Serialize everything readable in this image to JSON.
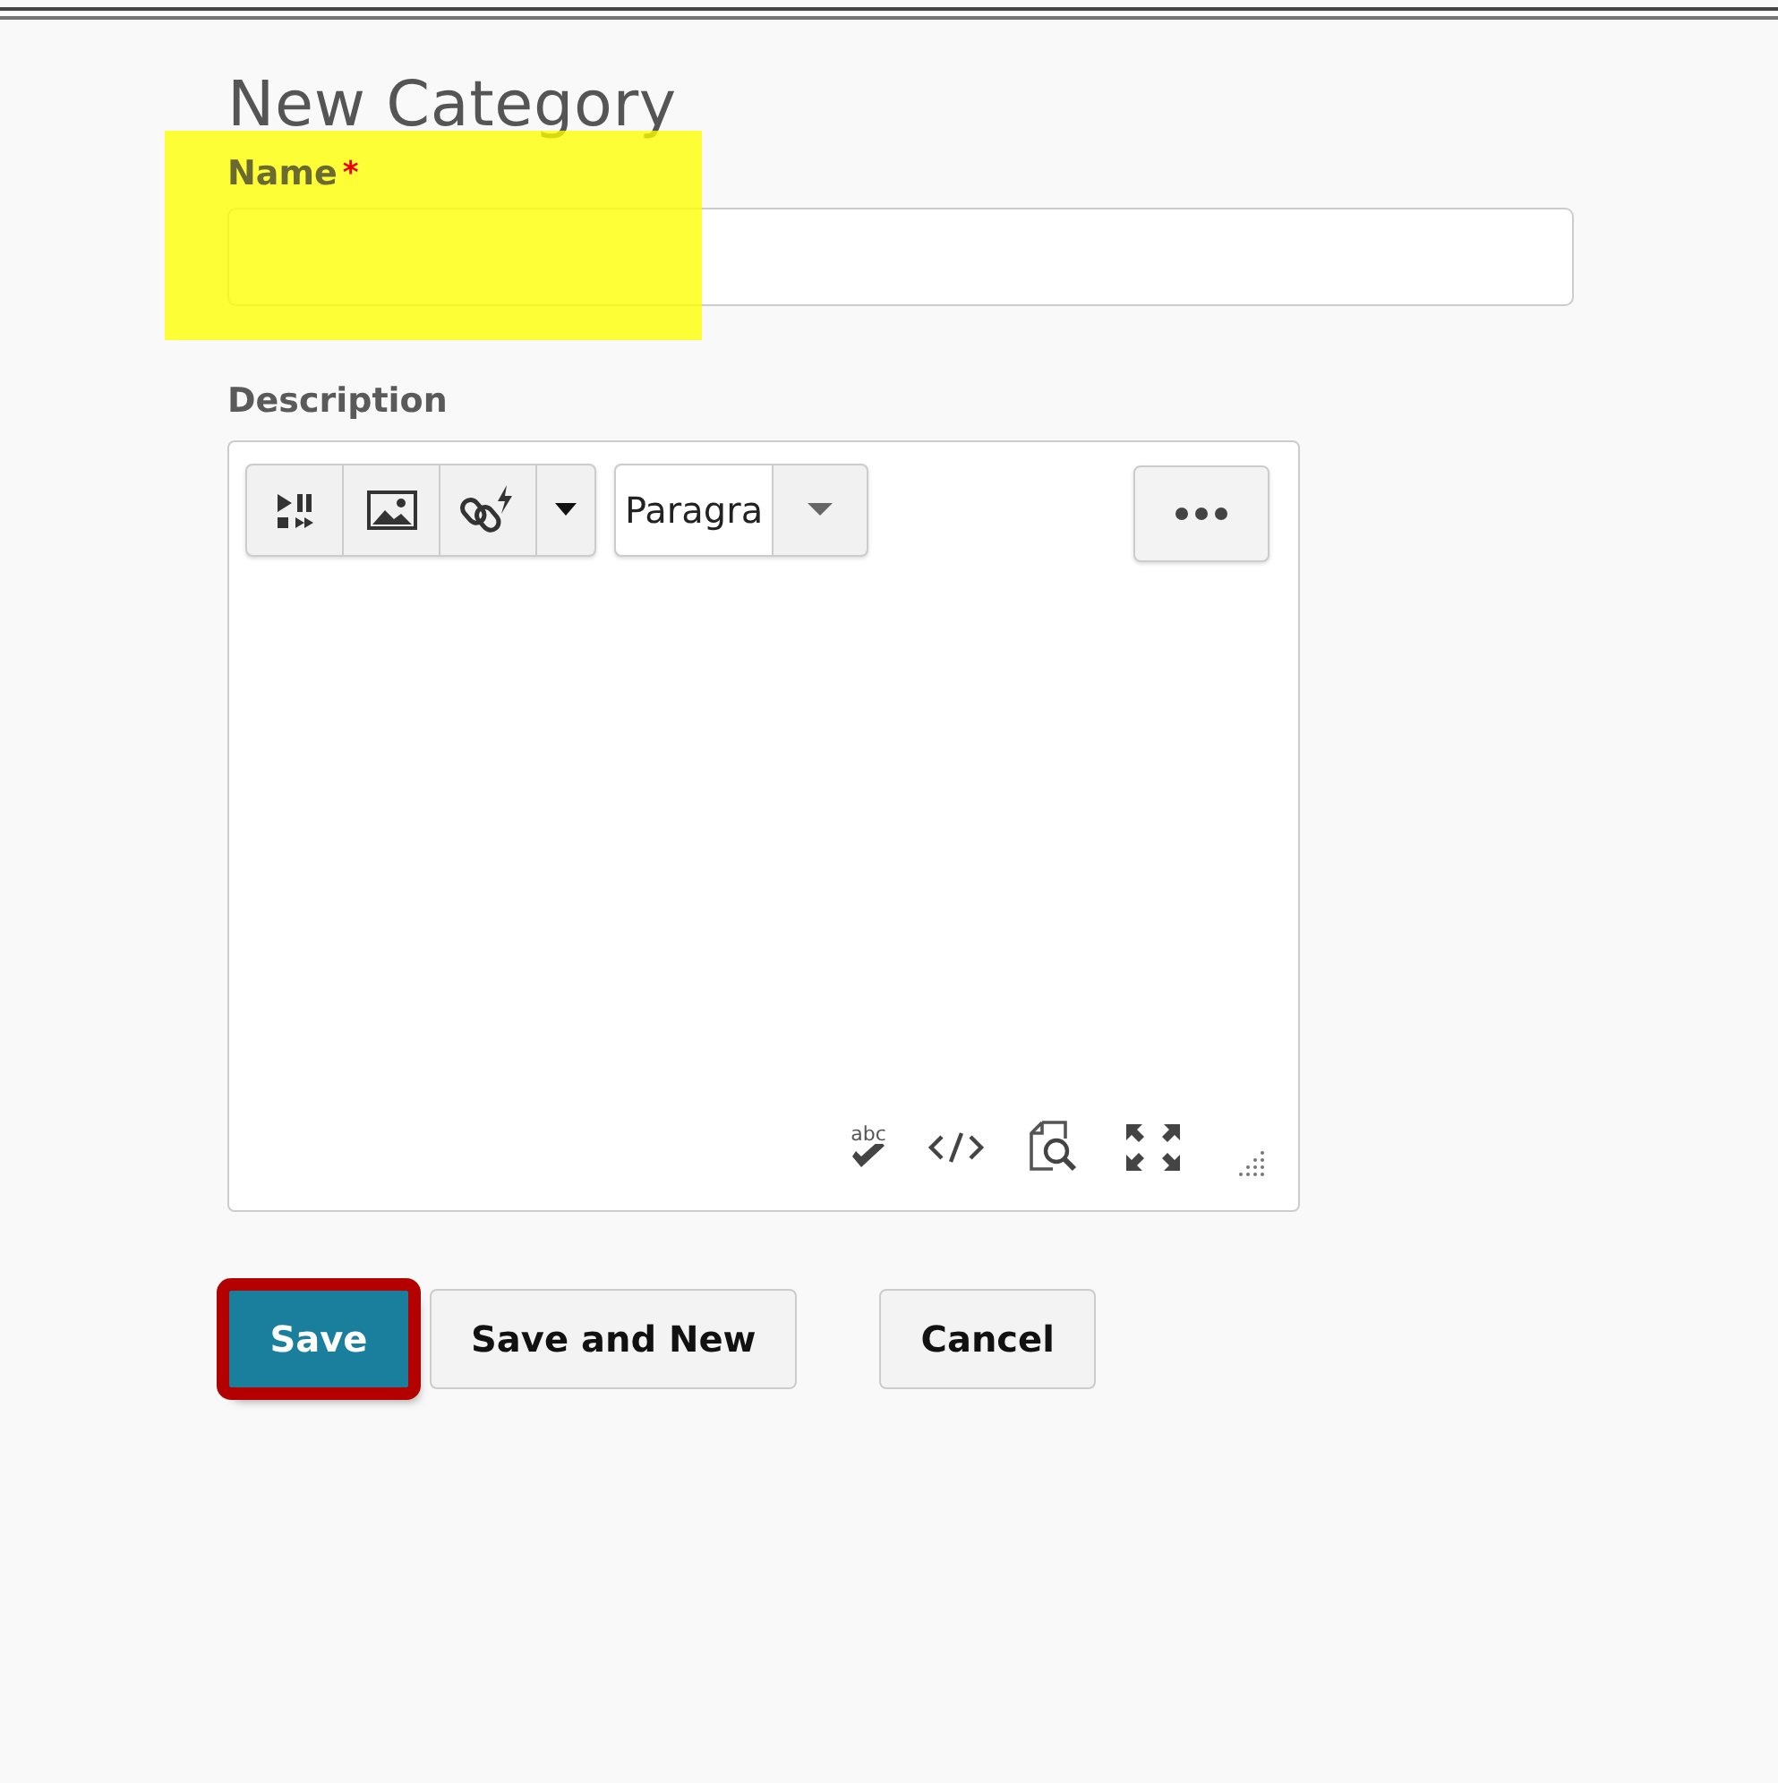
{
  "title": "New Category",
  "name_field": {
    "label": "Name",
    "required_mark": "*",
    "highlighted": true
  },
  "description": {
    "label": "Description",
    "format_value": "Paragra",
    "spellcheck_text": "abc"
  },
  "buttons": [
    {
      "label": "Save",
      "kind": "primary",
      "highlighted": true
    },
    {
      "label": "Save and New",
      "kind": "normal",
      "highlighted": false
    },
    {
      "label": "Cancel",
      "kind": "normal",
      "highlighted": false
    }
  ]
}
